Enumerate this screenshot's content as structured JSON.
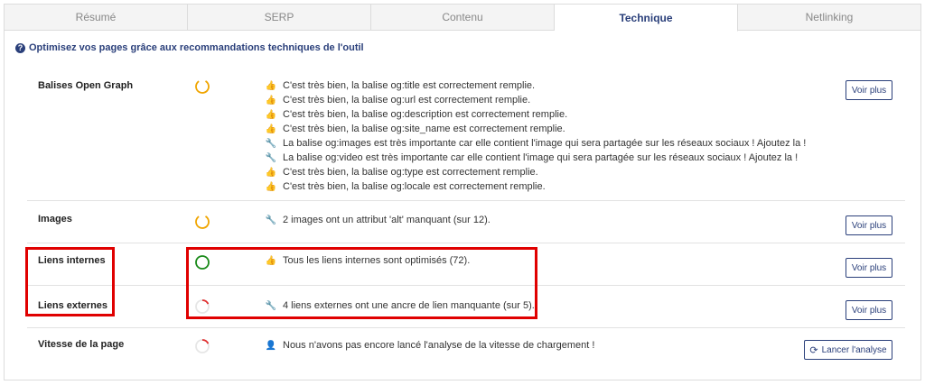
{
  "tabs": [
    {
      "label": "Résumé",
      "active": false
    },
    {
      "label": "SERP",
      "active": false
    },
    {
      "label": "Contenu",
      "active": false
    },
    {
      "label": "Technique",
      "active": true
    },
    {
      "label": "Netlinking",
      "active": false
    }
  ],
  "info_text": "Optimisez vos pages grâce aux recommandations techniques de l'outil",
  "colors": {
    "accent": "#2a3f7a",
    "highlight": "#e00000",
    "score_orange": "#f0a500",
    "score_green": "#1a8a1a",
    "score_red": "#e03030"
  },
  "sections": {
    "og": {
      "label": "Balises Open Graph",
      "score_status": "orange",
      "button": "Voir plus",
      "messages": [
        {
          "icon": "thumbs-up-icon",
          "text": "C'est très bien, la balise og:title est correctement remplie."
        },
        {
          "icon": "thumbs-up-icon",
          "text": "C'est très bien, la balise og:url est correctement remplie."
        },
        {
          "icon": "thumbs-up-icon",
          "text": "C'est très bien, la balise og:description est correctement remplie."
        },
        {
          "icon": "thumbs-up-icon",
          "text": "C'est très bien, la balise og:site_name est correctement remplie."
        },
        {
          "icon": "wrench-icon",
          "text": "La balise og:images est très importante car elle contient l'image qui sera partagée sur les réseaux sociaux ! Ajoutez la !"
        },
        {
          "icon": "wrench-icon",
          "text": "La balise og:video est très importante car elle contient l'image qui sera partagée sur les réseaux sociaux ! Ajoutez la !"
        },
        {
          "icon": "thumbs-up-icon",
          "text": "C'est très bien, la balise og:type est correctement remplie."
        },
        {
          "icon": "thumbs-up-icon",
          "text": "C'est très bien, la balise og:locale est correctement remplie."
        }
      ]
    },
    "images": {
      "label": "Images",
      "score_status": "orange",
      "button": "Voir plus",
      "messages": [
        {
          "icon": "wrench-icon",
          "text": "2 images ont un attribut 'alt' manquant (sur 12)."
        }
      ]
    },
    "internal": {
      "label": "Liens internes",
      "score_status": "green",
      "button": "Voir plus",
      "messages": [
        {
          "icon": "thumbs-up-icon",
          "text": "Tous les liens internes sont optimisés (72)."
        }
      ]
    },
    "external": {
      "label": "Liens externes",
      "score_status": "red",
      "button": "Voir plus",
      "messages": [
        {
          "icon": "wrench-icon",
          "text": "4 liens externes ont une ancre de lien manquante (sur 5)."
        }
      ]
    },
    "speed": {
      "label": "Vitesse de la page",
      "score_status": "red",
      "button": "Lancer l'analyse",
      "messages": [
        {
          "icon": "user-icon",
          "text": "Nous n'avons pas encore lancé l'analyse de la vitesse de chargement !"
        }
      ]
    }
  }
}
